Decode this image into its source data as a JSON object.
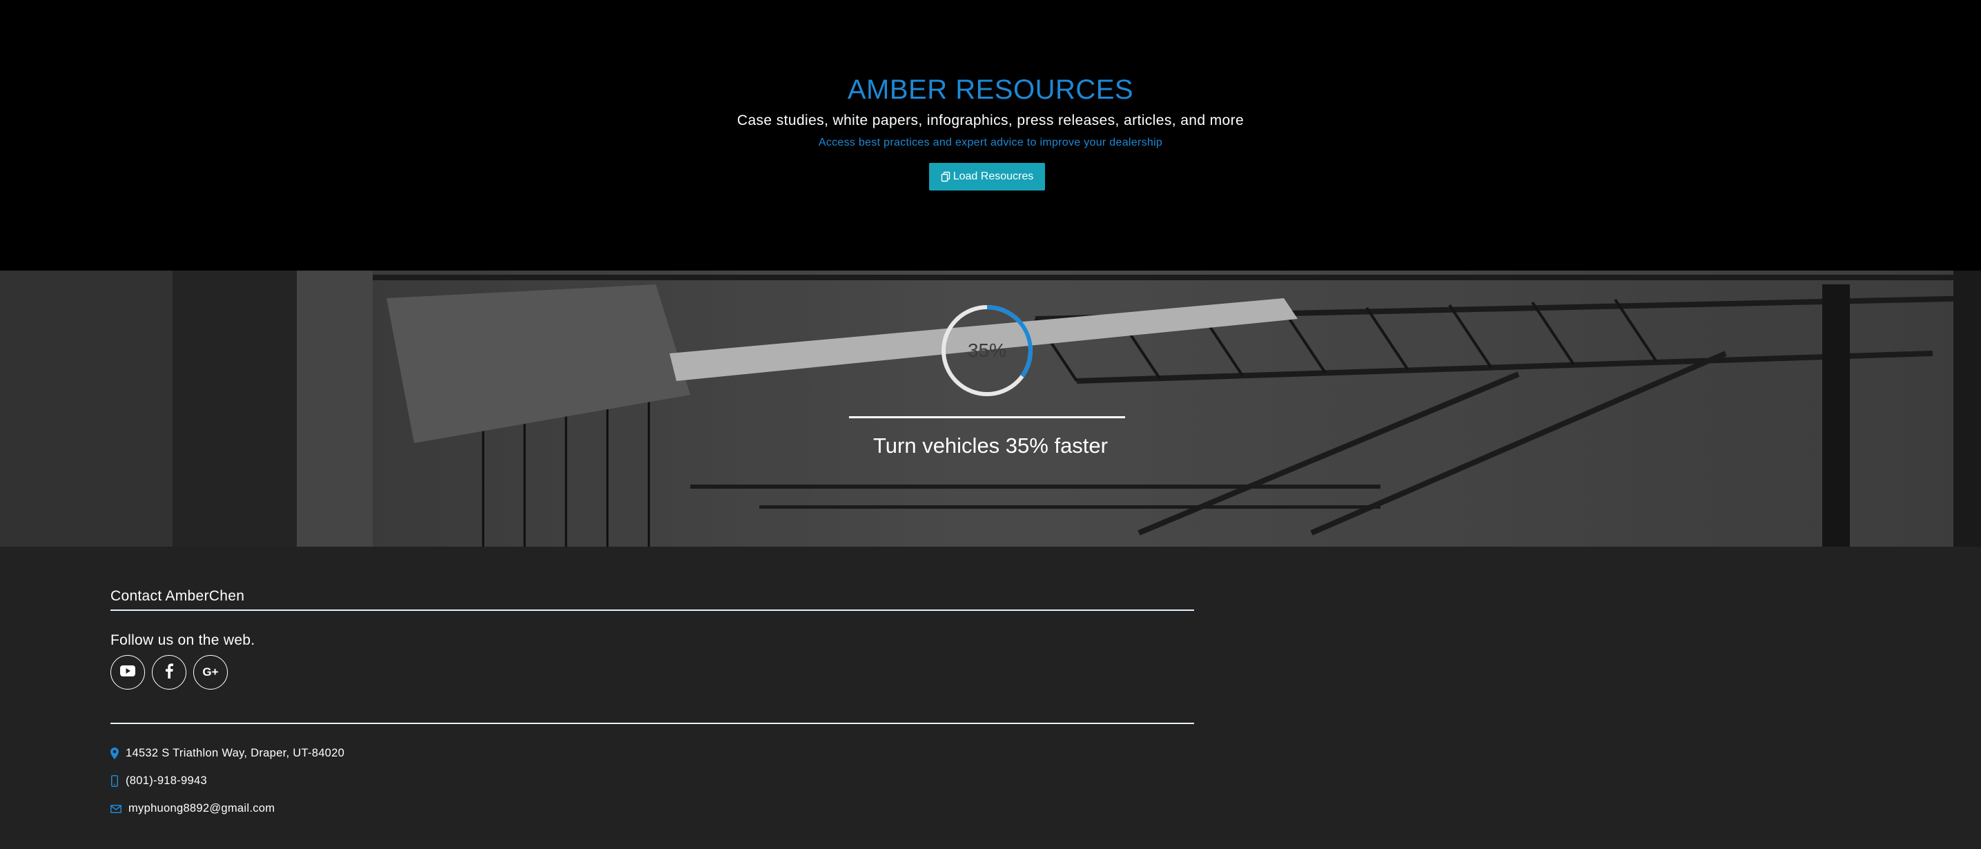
{
  "hero": {
    "title": "AMBER RESOURCES",
    "subtitle": "Case studies, white papers, infographics, press releases, articles, and more",
    "tagline": "Access best practices and expert advice to improve your dealership",
    "button_label": "Load Resoucres",
    "button_icon": "copy-icon"
  },
  "stat": {
    "percent": 35,
    "percent_label": "35%",
    "caption": "Turn vehicles 35% faster"
  },
  "footer": {
    "contact_title": "Contact AmberChen",
    "follow_title": "Follow us on the web.",
    "socials": [
      {
        "name": "youtube",
        "icon": "youtube-icon"
      },
      {
        "name": "facebook",
        "icon": "facebook-icon"
      },
      {
        "name": "google-plus",
        "icon": "google-plus-icon",
        "glyph": "G+"
      }
    ],
    "address": "14532 S Triathlon Way, Draper, UT-84020",
    "phone": "(801)-918-9943",
    "email": "myphuong8892@gmail.com"
  },
  "colors": {
    "accent_blue": "#1e88d6",
    "button_teal": "#17a2b8",
    "hero_bg": "#000000",
    "footer_bg": "#222222",
    "gauge_track": "#e8e8e8"
  }
}
